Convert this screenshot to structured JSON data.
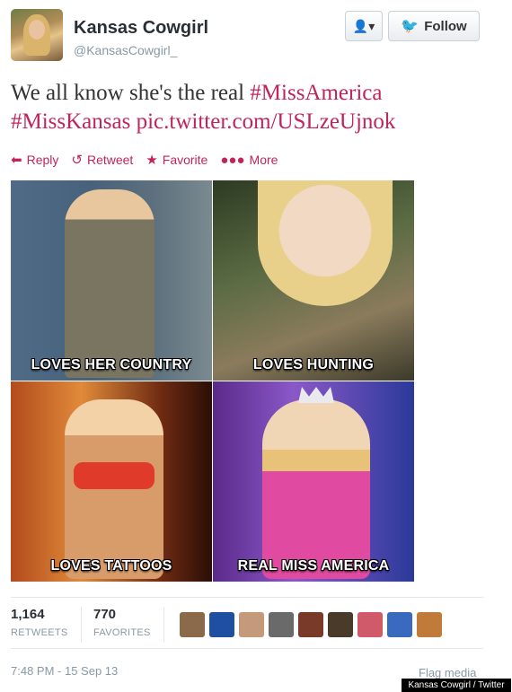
{
  "user": {
    "name": "Kansas Cowgirl",
    "handle": "@KansasCowgirl_"
  },
  "buttons": {
    "user_menu_icon": "person-icon",
    "follow_label": "Follow"
  },
  "tweet": {
    "text_plain": "We all know she's the real ",
    "hashtag1": "#MissAmerica",
    "hashtag2": "#MissKansas",
    "link": "pic.twitter.com/USLzeUjnok"
  },
  "actions": {
    "reply": "Reply",
    "retweet": "Retweet",
    "favorite": "Favorite",
    "more": "More"
  },
  "media": {
    "captions": [
      "LOVES HER COUNTRY",
      "LOVES HUNTING",
      "LOVES TATTOOS",
      "REAL MISS AMERICA"
    ]
  },
  "stats": {
    "retweets_count": "1,164",
    "retweets_label": "RETWEETS",
    "favorites_count": "770",
    "favorites_label": "FAVORITES",
    "favoriter_colors": [
      "#8a6a4a",
      "#1f4fa0",
      "#c49a7a",
      "#6a6a6a",
      "#7a3a2a",
      "#4a3a2a",
      "#d05a6a",
      "#3a6ac0",
      "#c07a3a"
    ]
  },
  "footer": {
    "timestamp": "7:48 PM - 15 Sep 13",
    "flag": "Flag media",
    "credit": "Kansas Cowgirl / Twitter"
  },
  "colors": {
    "accent": "#c0245b",
    "twitter_blue": "#1da1f2"
  }
}
